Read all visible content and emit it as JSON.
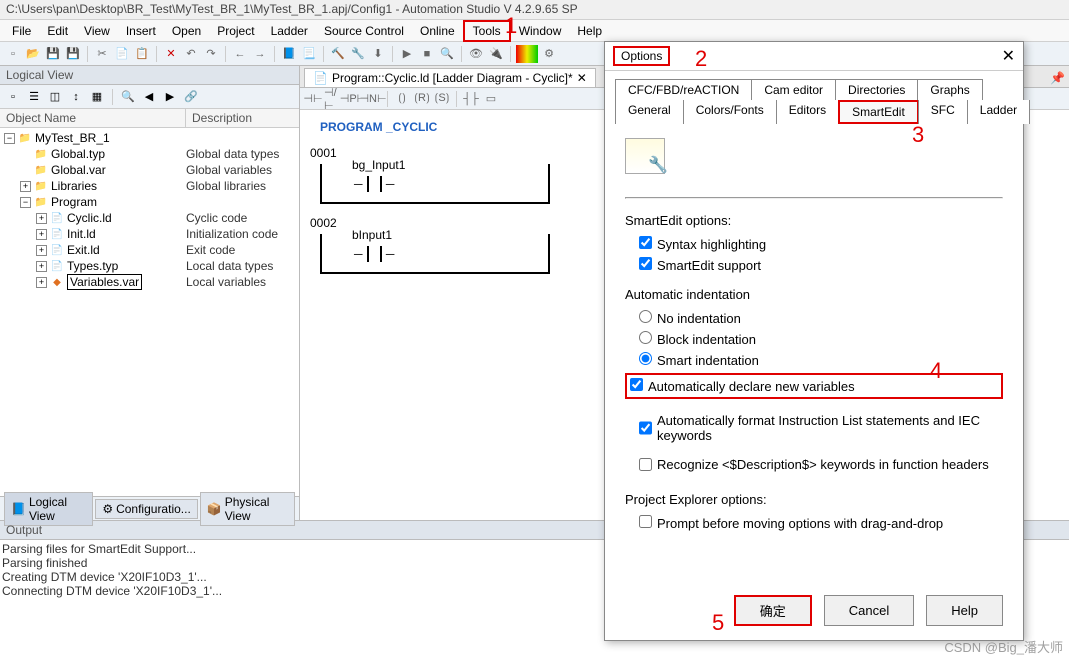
{
  "title": "C:\\Users\\pan\\Desktop\\BR_Test\\MyTest_BR_1\\MyTest_BR_1.apj/Config1 - Automation Studio V 4.2.9.65 SP",
  "menu": [
    "File",
    "Edit",
    "View",
    "Insert",
    "Open",
    "Project",
    "Ladder",
    "Source Control",
    "Online",
    "Tools",
    "Window",
    "Help"
  ],
  "sidebar": {
    "title": "Logical View",
    "cols": {
      "c1": "Object Name",
      "c2": "Description"
    },
    "items": [
      {
        "indent": 0,
        "exp": "−",
        "icon": "proj",
        "name": "MyTest_BR_1",
        "desc": ""
      },
      {
        "indent": 1,
        "exp": "",
        "icon": "folder",
        "name": "Global.typ",
        "desc": "Global data types"
      },
      {
        "indent": 1,
        "exp": "",
        "icon": "folder",
        "name": "Global.var",
        "desc": "Global variables"
      },
      {
        "indent": 1,
        "exp": "+",
        "icon": "folder",
        "name": "Libraries",
        "desc": "Global libraries"
      },
      {
        "indent": 1,
        "exp": "−",
        "icon": "folder",
        "name": "Program",
        "desc": ""
      },
      {
        "indent": 2,
        "exp": "+",
        "icon": "file",
        "name": "Cyclic.ld",
        "desc": "Cyclic code"
      },
      {
        "indent": 2,
        "exp": "+",
        "icon": "file",
        "name": "Init.ld",
        "desc": "Initialization code"
      },
      {
        "indent": 2,
        "exp": "+",
        "icon": "file",
        "name": "Exit.ld",
        "desc": "Exit code"
      },
      {
        "indent": 2,
        "exp": "+",
        "icon": "file",
        "name": "Types.typ",
        "desc": "Local data types"
      },
      {
        "indent": 2,
        "exp": "+",
        "icon": "var",
        "name": "Variables.var",
        "desc": "Local variables",
        "selected": true
      }
    ],
    "bottomTabs": [
      {
        "label": "Logical View",
        "icon": "📘",
        "active": true
      },
      {
        "label": "Configuratio...",
        "icon": "⚙",
        "active": false
      },
      {
        "label": "Physical View",
        "icon": "📦",
        "active": false
      }
    ]
  },
  "editor": {
    "tab": "Program::Cyclic.ld [Ladder Diagram - Cyclic]*",
    "progLabel": "PROGRAM _CYCLIC",
    "rungs": [
      {
        "num": "0001",
        "label": "bg_Input1"
      },
      {
        "num": "0002",
        "label": "bInput1"
      }
    ]
  },
  "output": {
    "title": "Output",
    "lines": [
      "Parsing files for SmartEdit Support...",
      "Parsing finished",
      "Creating DTM device 'X20IF10D3_1'...",
      "Connecting DTM device 'X20IF10D3_1'..."
    ]
  },
  "dialog": {
    "title": "Options",
    "tabsTop": [
      "CFC/FBD/reACTION",
      "Cam editor",
      "Directories",
      "Graphs"
    ],
    "tabsBottom": [
      "General",
      "Colors/Fonts",
      "Editors",
      "SmartEdit",
      "SFC",
      "Ladder"
    ],
    "sections": {
      "s1": "SmartEdit options:",
      "s2": "Automatic indentation",
      "s3": "Project Explorer options:"
    },
    "opts": {
      "syntax": "Syntax highlighting",
      "smartedit": "SmartEdit support",
      "noindent": "No indentation",
      "blockindent": "Block indentation",
      "smartindent": "Smart indentation",
      "autodecl": "Automatically declare new variables",
      "autofmt": "Automatically format Instruction List statements and IEC keywords",
      "recognize": "Recognize <$Description$> keywords in function headers",
      "prompt": "Prompt before moving options with drag-and-drop"
    },
    "buttons": {
      "ok": "确定",
      "cancel": "Cancel",
      "help": "Help"
    }
  },
  "annotations": {
    "a1": "1",
    "a2": "2",
    "a3": "3",
    "a4": "4",
    "a5": "5"
  },
  "watermark": "CSDN @Big_潘大师"
}
